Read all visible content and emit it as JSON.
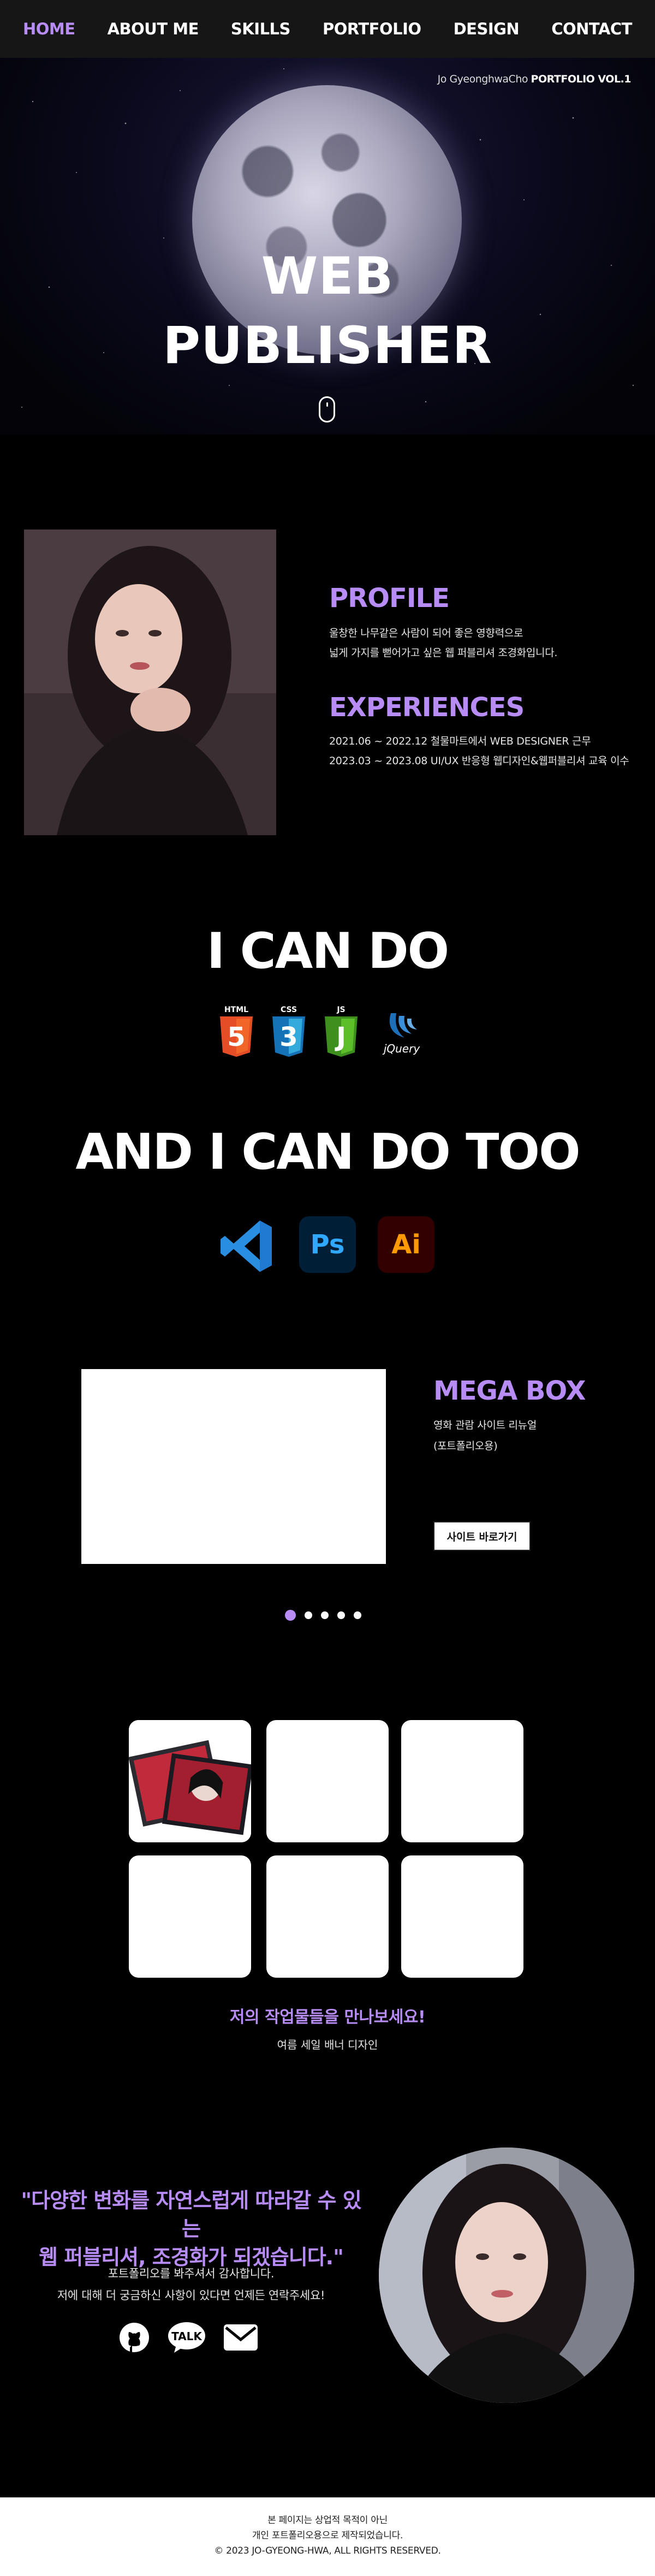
{
  "nav": {
    "items": [
      {
        "label": "HOME",
        "active": true
      },
      {
        "label": "ABOUT ME",
        "active": false
      },
      {
        "label": "SKILLS",
        "active": false
      },
      {
        "label": "PORTFOLIO",
        "active": false
      },
      {
        "label": "DESIGN",
        "active": false
      },
      {
        "label": "CONTACT",
        "active": false
      }
    ]
  },
  "hero": {
    "tag_name": "Jo GyeonghwaCho ",
    "tag_bold": "PORTFOLIO VOL.1",
    "title_line1": "WEB",
    "title_line2": "PUBLISHER"
  },
  "about": {
    "profile_title": "PROFILE",
    "profile_lines": [
      "울창한 나무같은 사람이 되어 좋은 영향력으로",
      "넓게 가지를 뻗어가고 싶은 웹 퍼블리셔 조경화입니다."
    ],
    "experiences_title": "EXPERIENCES",
    "experience_lines": [
      "2021.06 ~ 2022.12 철물마트에서 WEB DESIGNER 근무",
      "2023.03 ~ 2023.08 UI/UX 반응형 웹디자인&웹퍼블리셔 교육 이수"
    ]
  },
  "skills": {
    "heading1": "I CAN DO",
    "icons1": [
      {
        "icon": "html5-icon",
        "label": "HTML",
        "num": "5",
        "color": "#e44d26"
      },
      {
        "icon": "css3-icon",
        "label": "CSS",
        "num": "3",
        "color": "#1572b6"
      },
      {
        "icon": "js-icon",
        "label": "JS",
        "num": "J",
        "color": "#4caf24"
      },
      {
        "icon": "jquery-icon",
        "label": "jQuery",
        "color": "#1d6fb8"
      }
    ],
    "heading2": "AND I CAN DO TOO",
    "icons2": [
      {
        "icon": "vscode-icon",
        "color": "#2a8ee0"
      },
      {
        "icon": "photoshop-icon",
        "label": "Ps",
        "color": "#31a8ff",
        "bg": "#001e36"
      },
      {
        "icon": "illustrator-icon",
        "label": "Ai",
        "color": "#ff9a00",
        "bg": "#330000"
      }
    ]
  },
  "portfolio": {
    "title": "MEGA BOX",
    "desc_line1": "영화 관람 사이트 리뉴얼",
    "desc_line2": "(포트폴리오용)",
    "button": "사이트 바로가기",
    "slides_count": 5,
    "active_slide": 1
  },
  "design": {
    "heading": "저의 작업물들을 만나보세요!",
    "caption": "여름 세일 배너 디자인"
  },
  "contact": {
    "quote_line1": "\"다양한 변화를 자연스럽게 따라갈 수 있는",
    "quote_line2": "웹 퍼블리셔, 조경화가 되겠습니다.\"",
    "text_line1": "포트폴리오를 봐주셔서 감사합니다.",
    "text_line2": "저에 대해 더 궁금하신 사항이 있다면 언제든 연락주세요!",
    "social": [
      {
        "icon": "github-icon"
      },
      {
        "icon": "kakaotalk-icon",
        "label": "TALK"
      },
      {
        "icon": "mail-icon"
      }
    ],
    "accent": "#b78cf5"
  },
  "footer": {
    "line1": "본 페이지는 상업적 목적이 아닌",
    "line2": "개인 포트폴리오용으로 제작되었습니다.",
    "line3": "© 2023 JO-GYEONG-HWA, ALL RIGHTS RESERVED."
  }
}
